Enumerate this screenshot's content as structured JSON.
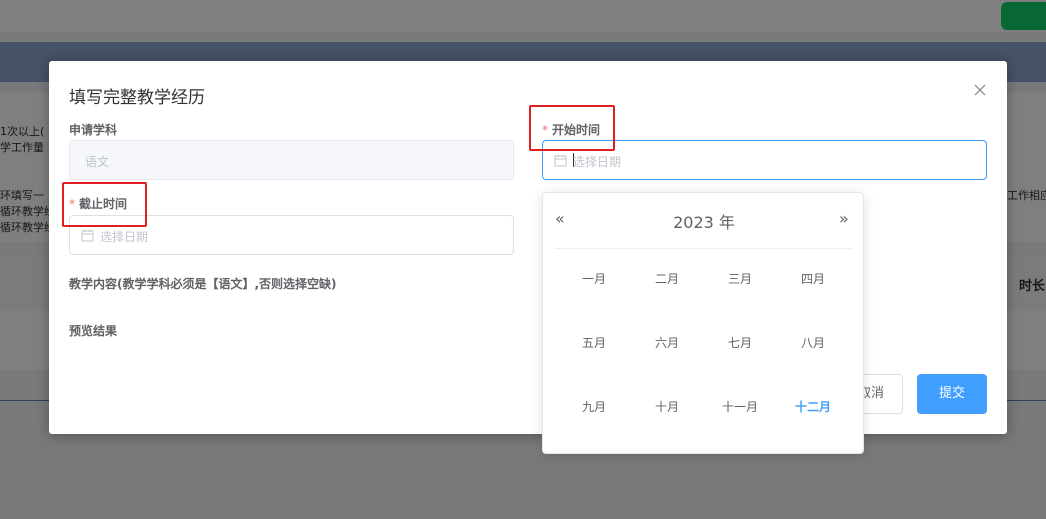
{
  "background": {
    "fragments": [
      "1次以上(",
      "学工作量",
      "环填写一",
      "循环教学经",
      "循环教学经",
      "工作相应"
    ],
    "table_header_right": "时长"
  },
  "dialog": {
    "title": "填写完整教学经历",
    "subject": {
      "label": "申请学科",
      "value": "语文"
    },
    "start_time": {
      "required_mark": "*",
      "label": "开始时间",
      "placeholder": "选择日期"
    },
    "end_time": {
      "required_mark": "*",
      "label": "截止时间",
      "placeholder": "选择日期"
    },
    "content_label": "教学内容(教学学科必须是【语文】,否则选择空缺)",
    "preview_label": "预览结果",
    "cancel_label": "取消",
    "submit_label": "提交"
  },
  "picker": {
    "prev_symbol": "«",
    "next_symbol": "»",
    "year_label": "2023 年",
    "months": [
      "一月",
      "二月",
      "三月",
      "四月",
      "五月",
      "六月",
      "七月",
      "八月",
      "九月",
      "十月",
      "十一月",
      "十二月"
    ],
    "current_month": "十二月"
  },
  "colors": {
    "accent": "#409eff",
    "required": "#f56c6c",
    "highlight_box": "#e02020"
  }
}
